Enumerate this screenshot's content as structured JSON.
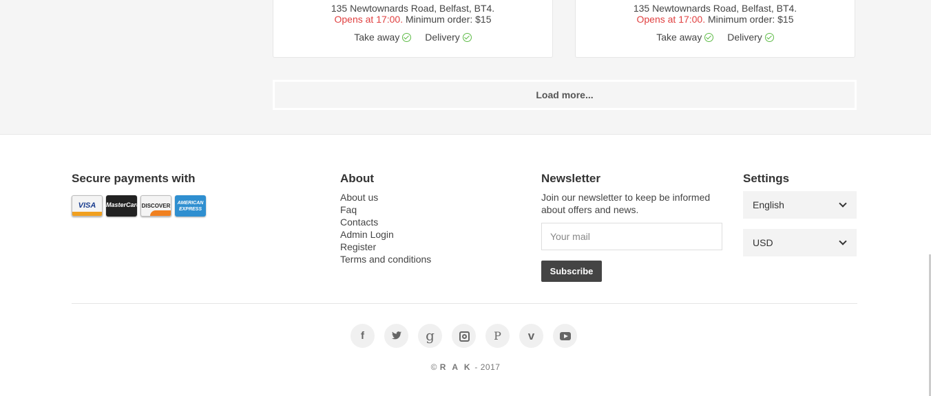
{
  "restaurants": [
    {
      "address": "135 Newtownards Road, Belfast, BT4.",
      "opens": "Opens at 17:00.",
      "min_order": "Minimum order: $15",
      "takeaway": "Take away",
      "delivery": "Delivery"
    },
    {
      "address": "135 Newtownards Road, Belfast, BT4.",
      "opens": "Opens at 17:00.",
      "min_order": "Minimum order: $15",
      "takeaway": "Take away",
      "delivery": "Delivery"
    }
  ],
  "load_more": "Load more...",
  "footer": {
    "payments_title": "Secure payments with",
    "cards": [
      "VISA",
      "MasterCard",
      "DISCOVER",
      "AMERICAN EXPRESS"
    ],
    "about_title": "About",
    "about_links": [
      "About us",
      "Faq",
      "Contacts",
      "Admin Login",
      "Register",
      "Terms and conditions"
    ],
    "newsletter_title": "Newsletter",
    "newsletter_text": "Join our newsletter to keep be informed about offers and news.",
    "mail_placeholder": "Your mail",
    "subscribe_label": "Subscribe",
    "settings_title": "Settings",
    "language": "English",
    "currency": "USD",
    "social_icons": [
      "facebook-icon",
      "twitter-icon",
      "google-plus-icon",
      "instagram-icon",
      "pinterest-icon",
      "vimeo-icon",
      "youtube-icon"
    ],
    "social_glyphs": {
      "facebook": "f",
      "twitter": "🐦",
      "google": "g",
      "pinterest": "P",
      "vimeo": "v"
    },
    "copyright_symbol": "©",
    "copyright_brand": "R A K",
    "copyright_year": "- 2017"
  }
}
